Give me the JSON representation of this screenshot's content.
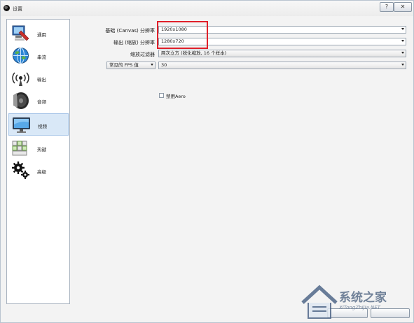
{
  "window": {
    "title": "设置"
  },
  "titlebar": {
    "help_glyph": "?",
    "close_glyph": "✕"
  },
  "sidebar": {
    "items": [
      {
        "label": "通用",
        "icon": "general-settings-icon"
      },
      {
        "label": "串流",
        "icon": "stream-globe-icon"
      },
      {
        "label": "输出",
        "icon": "output-antenna-icon"
      },
      {
        "label": "音频",
        "icon": "audio-speaker-icon"
      },
      {
        "label": "视频",
        "icon": "video-monitor-icon",
        "active": true
      },
      {
        "label": "热键",
        "icon": "hotkeys-keyboard-icon"
      },
      {
        "label": "高级",
        "icon": "advanced-gears-icon"
      }
    ]
  },
  "video": {
    "base_resolution_label": "基础 (Canvas) 分辨率",
    "base_resolution_value": "1920x1080",
    "output_resolution_label": "输出 (缩放) 分辨率",
    "output_resolution_value": "1280x720",
    "downscale_filter_label": "缩放过滤器",
    "downscale_filter_value": "两次立方 (锐化缩放, 16 个样本)",
    "fps_type_value": "常见的 FPS 值",
    "fps_value": "30",
    "disable_aero_label": "禁用Aero"
  },
  "colors": {
    "highlight": "#e0202a",
    "active_item_bg": "#d9e8f7"
  },
  "watermark": {
    "brand": "系统之家",
    "url": "XiTongZhiJia.NET"
  }
}
